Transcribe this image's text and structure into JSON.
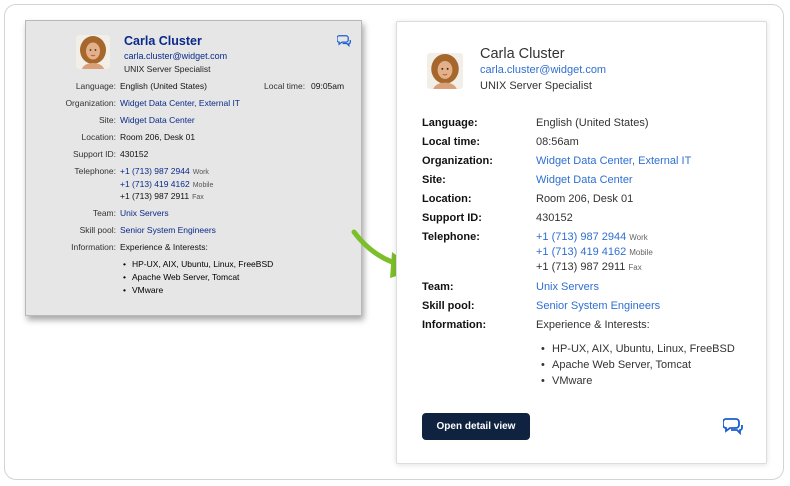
{
  "old_card": {
    "name": "Carla Cluster",
    "email": "carla.cluster@widget.com",
    "title": "UNIX Server Specialist",
    "rows": {
      "language": {
        "label": "Language:",
        "value": "English (United States)"
      },
      "local_time": {
        "label": "Local time:",
        "value": "09:05am"
      },
      "organization": {
        "label": "Organization:",
        "value": "Widget Data Center, External IT"
      },
      "site": {
        "label": "Site:",
        "value": "Widget Data Center"
      },
      "location": {
        "label": "Location:",
        "value": "Room 206, Desk 01"
      },
      "support_id": {
        "label": "Support ID:",
        "value": "430152"
      },
      "telephone": {
        "label": "Telephone:"
      },
      "team": {
        "label": "Team:",
        "value": "Unix Servers"
      },
      "skill_pool": {
        "label": "Skill pool:",
        "value": "Senior System Engineers"
      },
      "information": {
        "label": "Information:",
        "value": "Experience & Interests:"
      }
    },
    "phones": [
      {
        "number": "+1 (713) 987 2944",
        "type": "Work"
      },
      {
        "number": "+1 (713) 419 4162",
        "type": "Mobile"
      },
      {
        "number": "+1 (713) 987 2911",
        "type": "Fax"
      }
    ],
    "interests": [
      "HP-UX, AIX, Ubuntu, Linux, FreeBSD",
      "Apache Web Server, Tomcat",
      "VMware"
    ]
  },
  "new_card": {
    "name": "Carla Cluster",
    "email": "carla.cluster@widget.com",
    "title": "UNIX Server Specialist",
    "rows": {
      "language": {
        "label": "Language:",
        "value": "English (United States)"
      },
      "local_time": {
        "label": "Local time:",
        "value": "08:56am"
      },
      "organization": {
        "label": "Organization:",
        "value": "Widget Data Center, External IT"
      },
      "site": {
        "label": "Site:",
        "value": "Widget Data Center"
      },
      "location": {
        "label": "Location:",
        "value": "Room 206, Desk 01"
      },
      "support_id": {
        "label": "Support ID:",
        "value": "430152"
      },
      "telephone": {
        "label": "Telephone:"
      },
      "team": {
        "label": "Team:",
        "value": "Unix Servers"
      },
      "skill_pool": {
        "label": "Skill pool:",
        "value": "Senior System Engineers"
      },
      "information": {
        "label": "Information:",
        "value": "Experience & Interests:"
      }
    },
    "phones": [
      {
        "number": "+1 (713) 987 2944",
        "type": "Work"
      },
      {
        "number": "+1 (713) 419 4162",
        "type": "Mobile"
      },
      {
        "number": "+1 (713) 987 2911",
        "type": "Fax"
      }
    ],
    "interests": [
      "HP-UX, AIX, Ubuntu, Linux, FreeBSD",
      "Apache Web Server, Tomcat",
      "VMware"
    ],
    "detail_button": "Open detail view"
  },
  "icons": {
    "chat": "chat-bubbles-icon",
    "arrow": "curved-arrow-icon",
    "avatar": "avatar"
  },
  "colors": {
    "old_link": "#0a2a8a",
    "new_link": "#2f6fd1",
    "button_bg": "#0f2340",
    "arrow": "#7cbf2a"
  }
}
